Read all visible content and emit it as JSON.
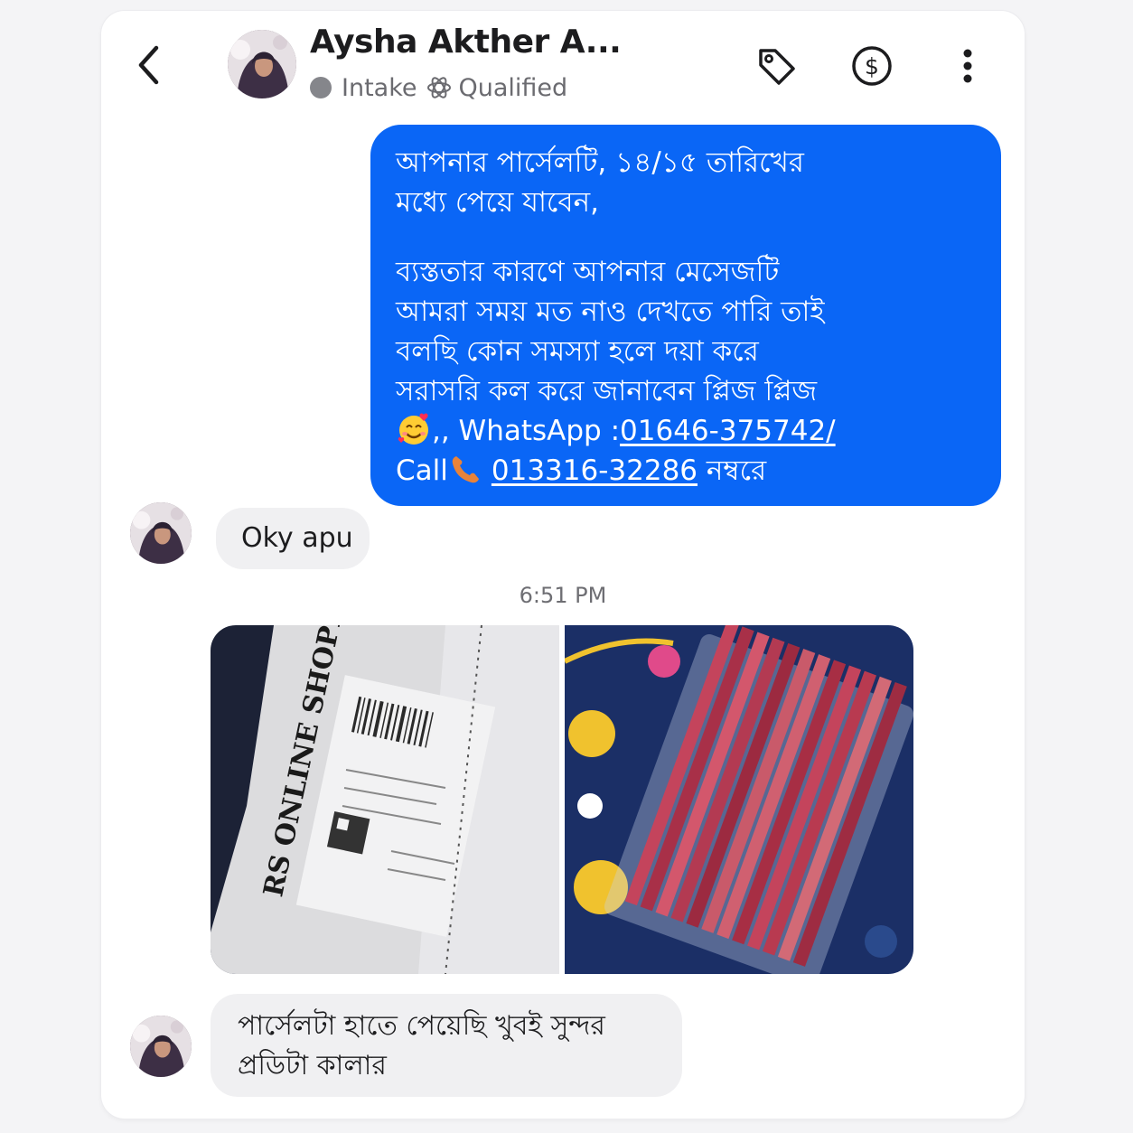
{
  "header": {
    "contact_name": "Aysha Akther A...",
    "stage": "Intake",
    "status": "Qualified",
    "icons": [
      "back-chevron",
      "tag-icon",
      "dollar-icon",
      "more-vertical-icon"
    ]
  },
  "colors": {
    "outgoing_bubble": "#0a66f6",
    "incoming_bubble": "#f0f0f2",
    "status_dot": "#85868b"
  },
  "messages": {
    "outgoing": {
      "line1": "আপনার পার্সেলটি, ১৪/১৫ তারিখের",
      "line2": "মধ্যে পেয়ে যাবেন,",
      "line3": "ব্যস্ততার কারণে আপনার মেসেজটি",
      "line4": "আমরা সময় মত নাও দেখতে পারি তাই",
      "line5": "বলছি কোন সমস্যা হলে দয়া করে",
      "line6": "সরাসরি কল করে জানাবেন প্লিজ প্লিজ",
      "whatsapp_prefix": ",,  WhatsApp :",
      "whatsapp_number": "01646-375742/",
      "call_label": "Call",
      "call_number": "013316-32286",
      "call_suffix": " নম্বরে"
    },
    "reply1": "Oky apu",
    "timestamp": "6:51 PM",
    "photos": [
      "parcel-package-photo",
      "lip-liner-pencils-photo"
    ],
    "reply2_line1": "পার্সেলটা হাতে পেয়েছি খুবই সুন্দর",
    "reply2_line2": "প্রডিটা কালার"
  }
}
